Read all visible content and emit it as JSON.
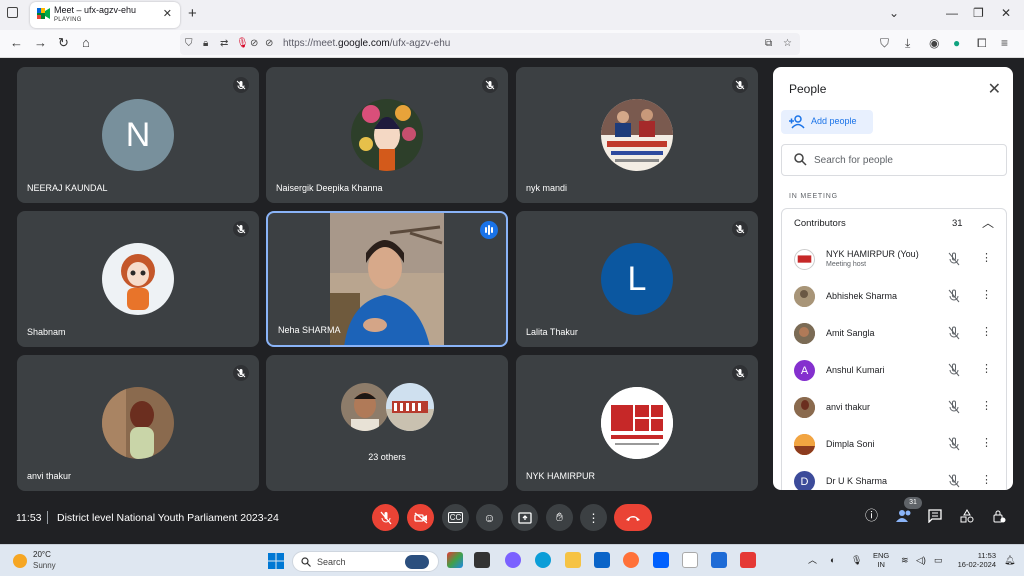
{
  "browser": {
    "tab_title": "Meet – ufx-agzv-ehu",
    "tab_status": "PLAYING",
    "url_host": "https://meet.",
    "url_domain": "google.com",
    "url_path": "/ufx-agzv-ehu"
  },
  "tiles": [
    {
      "name": "NEERAJ KAUNDAL",
      "initial": "N",
      "avatar_color": "#78909c"
    },
    {
      "name": "Naisergik Deepika Khanna"
    },
    {
      "name": "nyk mandi"
    },
    {
      "name": "Shabnam"
    },
    {
      "name": "Neha SHARMA"
    },
    {
      "name": "Lalita Thakur",
      "initial": "L",
      "avatar_color": "#0b57a0"
    },
    {
      "name": "anvi thakur"
    },
    {
      "others": "23 others"
    },
    {
      "name": "NYK HAMIRPUR"
    }
  ],
  "people_panel": {
    "title": "People",
    "add_label": "Add people",
    "search_placeholder": "Search for people",
    "section_label": "IN MEETING",
    "group_label": "Contributors",
    "group_count": "31",
    "participants": [
      {
        "name": "NYK HAMIRPUR (You)",
        "sub": "Meeting host"
      },
      {
        "name": "Abhishek Sharma"
      },
      {
        "name": "Amit Sangla"
      },
      {
        "name": "Anshul Kumari",
        "initial": "A",
        "color": "#8430ce"
      },
      {
        "name": "anvi thakur"
      },
      {
        "name": "Dimpla Soni"
      },
      {
        "name": "Dr U K Sharma",
        "initial": "D",
        "color": "#3c4b9a"
      }
    ]
  },
  "bottom_bar": {
    "time": "11:53",
    "meeting_title": "District level National Youth Parliament 2023-24",
    "people_count": "31"
  },
  "taskbar": {
    "temperature": "20°C",
    "weather": "Sunny",
    "search_label": "Search",
    "lang1": "ENG",
    "lang2": "IN",
    "time": "11:53",
    "date": "16-02-2024"
  }
}
